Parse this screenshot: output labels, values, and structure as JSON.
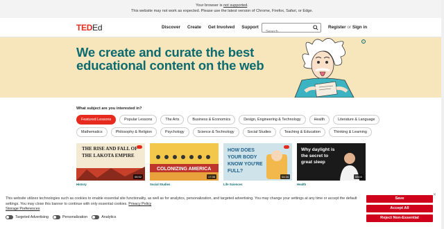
{
  "browser_warning": {
    "line1_prefix": "Your browser is ",
    "line1_link": "not supported",
    "line1_suffix": ".",
    "line2": "This website may not work as expected. Please use the latest version of Chrome, Firefox, Safari, or Edge."
  },
  "header": {
    "logo_ted": "TED",
    "logo_ed": "Ed",
    "nav": [
      "Discover",
      "Create",
      "Get Involved",
      "Support"
    ],
    "search_placeholder": "Search",
    "register": "Register",
    "or": "or",
    "signin": "Sign in"
  },
  "hero": {
    "title": "We create and curate the best educational content on the web"
  },
  "subjects": {
    "question": "What subject are you interested in?",
    "row1": [
      "Featured Lessons",
      "Popular Lessons",
      "The Arts",
      "Business & Economics",
      "Design, Engineering & Technology",
      "Health",
      "Literature & Language"
    ],
    "row2": [
      "Mathematics",
      "Philosophy & Religion",
      "Psychology",
      "Science & Technology",
      "Social Studies",
      "Teaching & Education",
      "Thinking & Learning"
    ]
  },
  "cards": [
    {
      "thumb_text": [
        "THE RISE AND FALL OF",
        "THE LAKOTA EMPIRE"
      ],
      "duration": "06:52",
      "category": "History"
    },
    {
      "thumb_text": [
        "COLONIZING AMERICA"
      ],
      "duration": "17:36",
      "category": "Social Studies"
    },
    {
      "thumb_text": [
        "HOW DOES",
        "YOUR BODY",
        "KNOW YOU'RE",
        "FULL?"
      ],
      "duration": "04:34",
      "category": "Life Sciences"
    },
    {
      "thumb_text": [
        "Why daylight is",
        "the secret to",
        "great sleep"
      ],
      "duration": "09:03",
      "category": "Health"
    }
  ],
  "cookie": {
    "text": "This website utilizes technologies such as cookies to enable essential site functionality, as well as for analytics, personalization, and targeted advertising. You may change your settings at any time or accept the default settings. You may close this banner to continue with only essential cookies.",
    "privacy_link": "Privacy Policy",
    "storage_prefs": "Storage Preferences",
    "toggles": [
      "Targeted Advertising",
      "Personalization",
      "Analytics"
    ],
    "save": "Save",
    "accept_all": "Accept All",
    "reject": "Reject Non-Essential"
  },
  "colors": {
    "brand_red": "#e62b1e",
    "hero_bg": "#f7e5bc",
    "hero_text": "#0b6b6f"
  }
}
